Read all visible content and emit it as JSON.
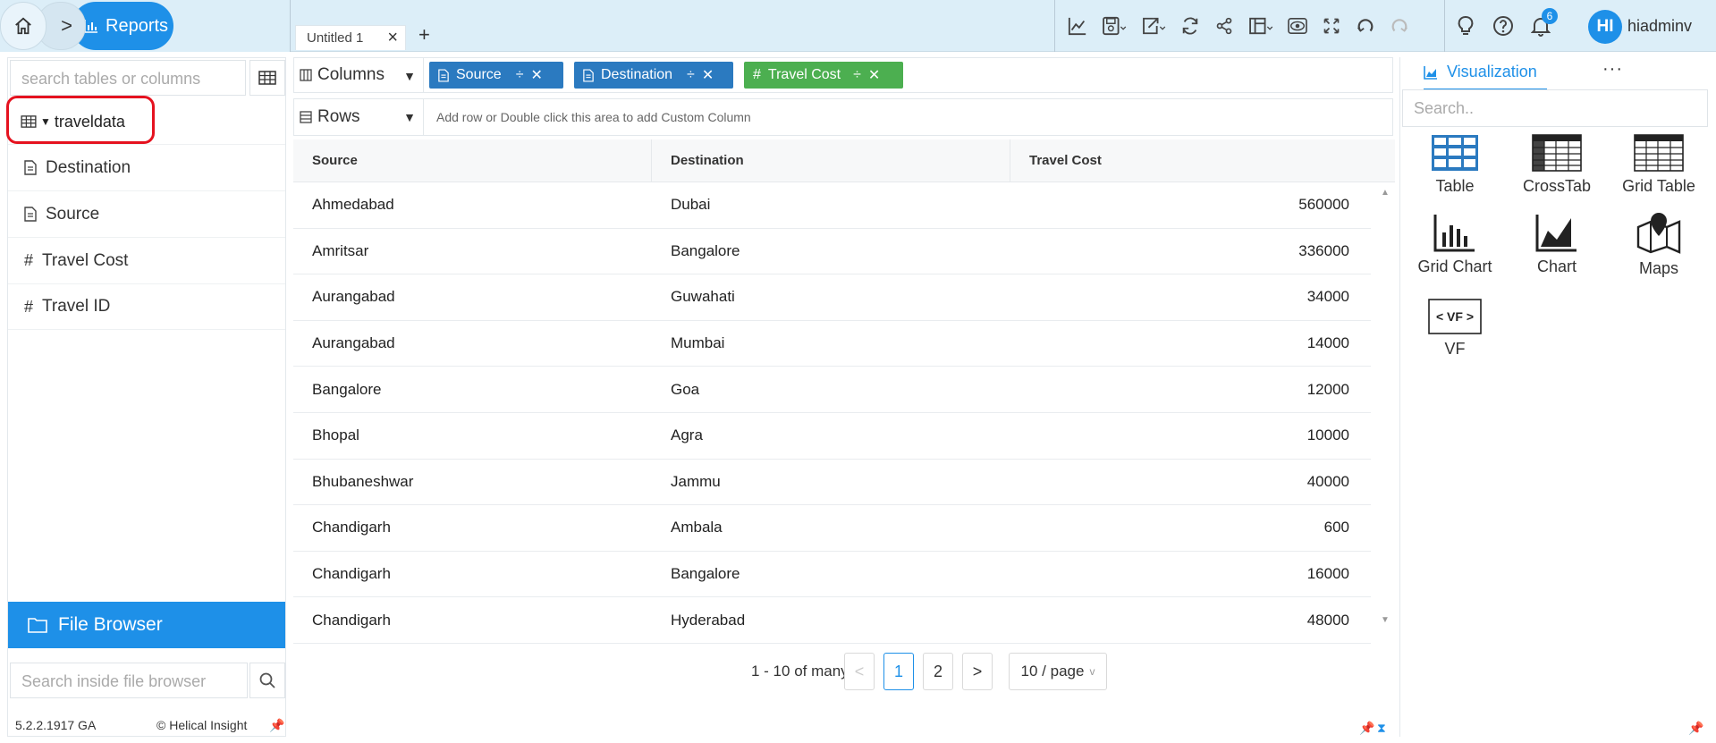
{
  "breadcrumb": {
    "home_icon": "home-icon",
    "reports_label": "Reports"
  },
  "tabs": [
    {
      "label": "Untitled 1"
    }
  ],
  "header": {
    "notifications_count": "6",
    "avatar_initials": "HI",
    "username": "hiadmin"
  },
  "left_panel": {
    "search_placeholder": "search tables or columns",
    "tree_root": "traveldata",
    "fields": [
      {
        "type": "text",
        "label": "Destination"
      },
      {
        "type": "text",
        "label": "Source"
      },
      {
        "type": "number",
        "label": "Travel Cost"
      },
      {
        "type": "number",
        "label": "Travel ID"
      }
    ],
    "file_browser_label": "File Browser",
    "file_browser_search_placeholder": "Search inside file browser",
    "version": "5.2.2.1917 GA",
    "copyright": "Helical Insight"
  },
  "shelves": {
    "columns_label": "Columns",
    "rows_label": "Rows",
    "rows_hint": "Add row or Double click this area to add Custom Column",
    "column_pills": [
      {
        "label": "Source",
        "color": "#2b7ac0"
      },
      {
        "label": "Destination",
        "color": "#2b7ac0"
      },
      {
        "label": "Travel Cost",
        "color": "#4caf50"
      }
    ]
  },
  "table": {
    "headers": [
      "Source",
      "Destination",
      "Travel Cost"
    ],
    "rows": [
      [
        "Ahmedabad",
        "Dubai",
        "560000"
      ],
      [
        "Amritsar",
        "Bangalore",
        "336000"
      ],
      [
        "Aurangabad",
        "Guwahati",
        "34000"
      ],
      [
        "Aurangabad",
        "Mumbai",
        "14000"
      ],
      [
        "Bangalore",
        "Goa",
        "12000"
      ],
      [
        "Bhopal",
        "Agra",
        "10000"
      ],
      [
        "Bhubaneshwar",
        "Jammu",
        "40000"
      ],
      [
        "Chandigarh",
        "Ambala",
        "600"
      ],
      [
        "Chandigarh",
        "Bangalore",
        "16000"
      ],
      [
        "Chandigarh",
        "Hyderabad",
        "48000"
      ]
    ]
  },
  "pagination": {
    "summary": "1 - 10 of many",
    "pages": [
      "1",
      "2"
    ],
    "page_size": "10 / page"
  },
  "visualization": {
    "tab_label": "Visualization",
    "search_placeholder": "Search..",
    "items": [
      "Table",
      "CrossTab",
      "Grid Table",
      "Grid Chart",
      "Chart",
      "Maps",
      "VF"
    ]
  },
  "colors": {
    "accent": "#1e90e8",
    "highlight": "#e5121f"
  }
}
